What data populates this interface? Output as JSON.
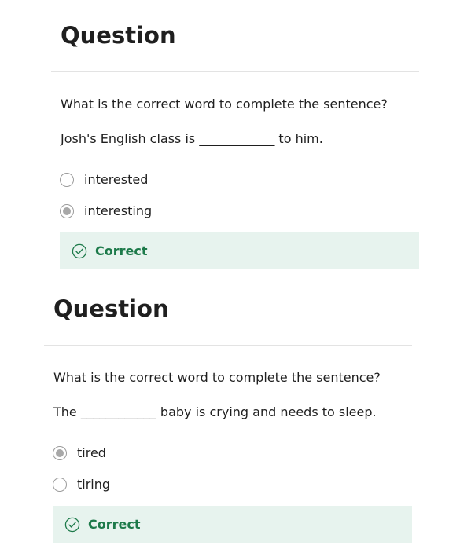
{
  "colors": {
    "text": "#1f1f1f",
    "divider": "#e3e3e3",
    "radio_border": "#9b9b9b",
    "radio_selected_fill": "#a8a8a8",
    "feedback_background": "#e7f3ee",
    "correct_green": "#1d7a4a"
  },
  "questions": [
    {
      "title": "Question",
      "prompt": "What is the correct word to complete the sentence?",
      "sentence": "Josh's English class is ____________ to him.",
      "options": [
        {
          "label": "interested",
          "selected": false
        },
        {
          "label": "interesting",
          "selected": true
        }
      ],
      "feedback": {
        "icon": "check-circle-icon",
        "label": "Correct"
      }
    },
    {
      "title": "Question",
      "prompt": "What is the correct word to complete the sentence?",
      "sentence": "The ____________ baby is crying and needs to sleep.",
      "options": [
        {
          "label": "tired",
          "selected": true
        },
        {
          "label": "tiring",
          "selected": false
        }
      ],
      "feedback": {
        "icon": "check-circle-icon",
        "label": "Correct"
      }
    }
  ]
}
